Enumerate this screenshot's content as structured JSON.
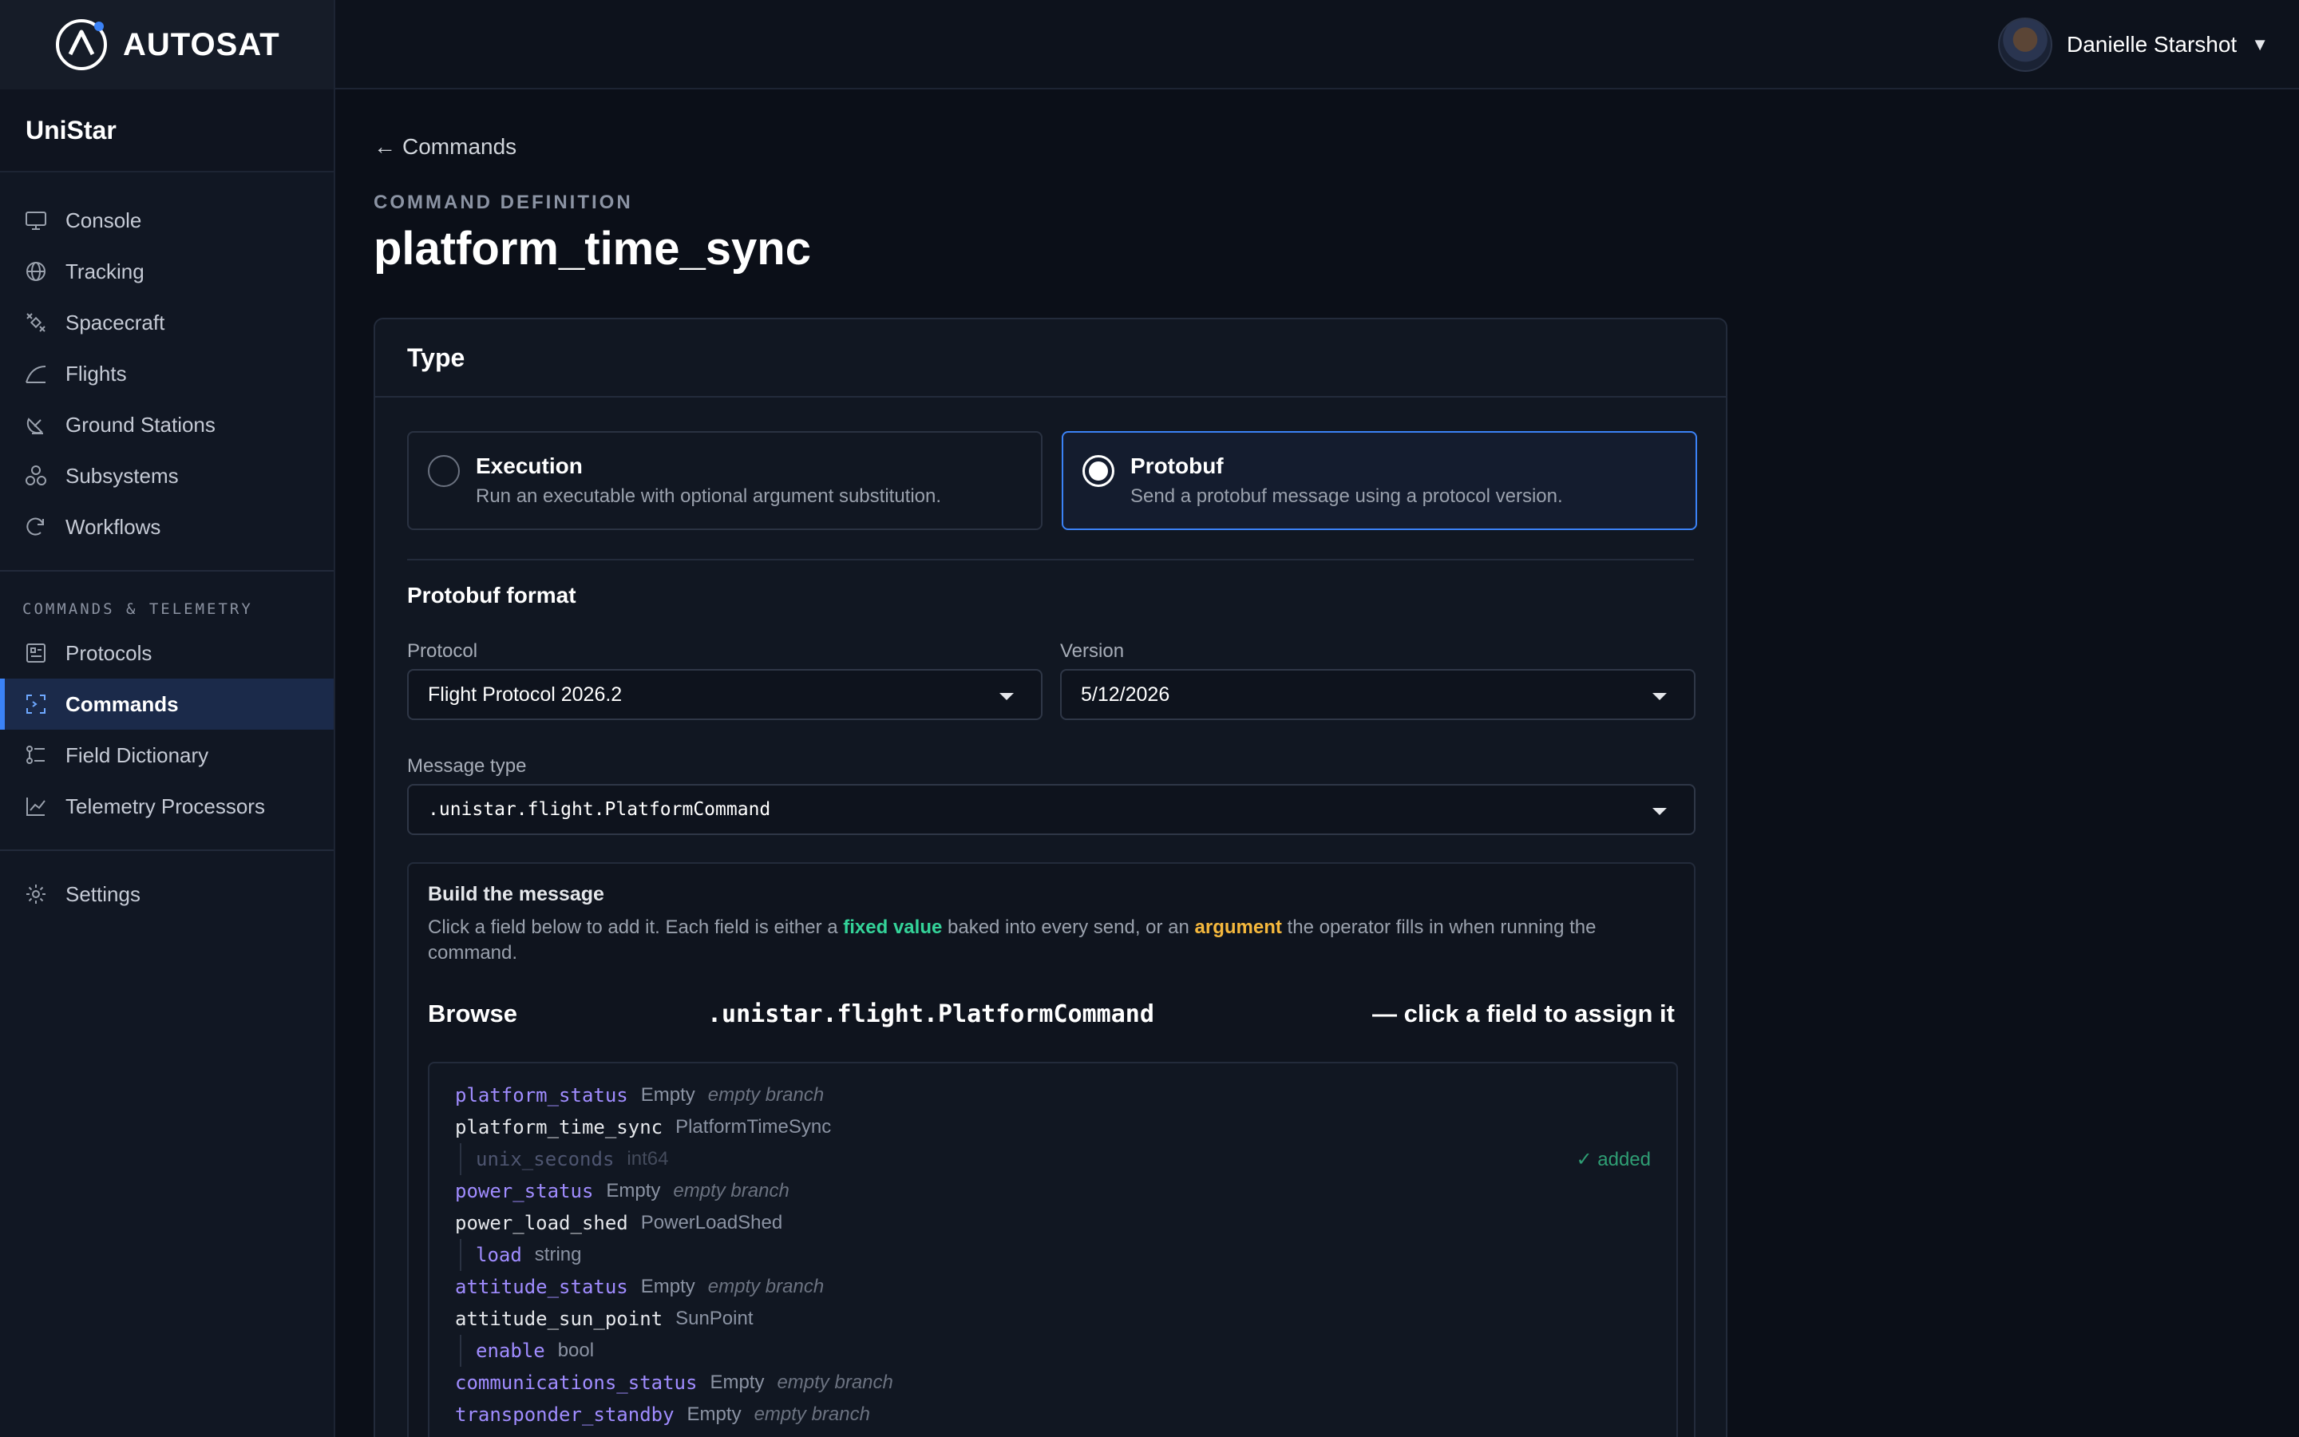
{
  "brand": {
    "name": "AUTOSAT",
    "org": "UniStar"
  },
  "user": {
    "name": "Danielle Starshot"
  },
  "sidebar": {
    "items": [
      {
        "label": "Console",
        "icon": "monitor-icon"
      },
      {
        "label": "Tracking",
        "icon": "globe-icon"
      },
      {
        "label": "Spacecraft",
        "icon": "satellite-icon"
      },
      {
        "label": "Flights",
        "icon": "trajectory-icon"
      },
      {
        "label": "Ground Stations",
        "icon": "antenna-icon"
      },
      {
        "label": "Subsystems",
        "icon": "subsystems-icon"
      },
      {
        "label": "Workflows",
        "icon": "workflow-icon"
      }
    ],
    "section_title": "COMMANDS & TELEMETRY",
    "section_items": [
      {
        "label": "Protocols",
        "icon": "protocol-icon"
      },
      {
        "label": "Commands",
        "icon": "command-icon",
        "active": true
      },
      {
        "label": "Field Dictionary",
        "icon": "dictionary-icon"
      },
      {
        "label": "Telemetry Processors",
        "icon": "chart-line-icon"
      }
    ],
    "settings": {
      "label": "Settings",
      "icon": "gear-icon"
    }
  },
  "page": {
    "back_label": "Commands",
    "eyebrow": "COMMAND DEFINITION",
    "title": "platform_time_sync"
  },
  "type_card": {
    "heading": "Type",
    "options": [
      {
        "title": "Execution",
        "desc": "Run an executable with optional argument substitution.",
        "selected": false
      },
      {
        "title": "Protobuf",
        "desc": "Send a protobuf message using a protocol version.",
        "selected": true
      }
    ]
  },
  "protobuf": {
    "heading": "Protobuf format",
    "protocol_label": "Protocol",
    "protocol_value": "Flight Protocol 2026.2",
    "version_label": "Version",
    "version_value": "5/12/2026",
    "message_type_label": "Message type",
    "message_type_value": ".unistar.flight.PlatformCommand"
  },
  "builder": {
    "title": "Build the message",
    "desc_1": "Click a field below to add it. Each field is either a ",
    "desc_fixed": "fixed value",
    "desc_2": " baked into every send, or an ",
    "desc_arg": "argument",
    "desc_3": " the operator fills in when running the command.",
    "browse_word": "Browse",
    "browse_type": ".unistar.flight.PlatformCommand",
    "browse_hint": "— click a field to assign it",
    "added_label": "✓ added"
  },
  "tree": [
    {
      "name": "platform_status",
      "type": "Empty",
      "note": "empty branch",
      "kind": "leaf",
      "child": false
    },
    {
      "name": "platform_time_sync",
      "type": "PlatformTimeSync",
      "note": "",
      "kind": "msg",
      "child": false
    },
    {
      "name": "unix_seconds",
      "type": "int64",
      "note": "",
      "kind": "dim",
      "child": true,
      "added": true
    },
    {
      "name": "power_status",
      "type": "Empty",
      "note": "empty branch",
      "kind": "leaf",
      "child": false
    },
    {
      "name": "power_load_shed",
      "type": "PowerLoadShed",
      "note": "",
      "kind": "msg",
      "child": false
    },
    {
      "name": "load",
      "type": "string",
      "note": "",
      "kind": "leaf",
      "child": true
    },
    {
      "name": "attitude_status",
      "type": "Empty",
      "note": "empty branch",
      "kind": "leaf",
      "child": false
    },
    {
      "name": "attitude_sun_point",
      "type": "SunPoint",
      "note": "",
      "kind": "msg",
      "child": false
    },
    {
      "name": "enable",
      "type": "bool",
      "note": "",
      "kind": "leaf",
      "child": true
    },
    {
      "name": "communications_status",
      "type": "Empty",
      "note": "empty branch",
      "kind": "leaf",
      "child": false
    },
    {
      "name": "transponder_standby",
      "type": "Empty",
      "note": "empty branch",
      "kind": "leaf",
      "child": false
    }
  ],
  "colors": {
    "accent": "#3b82f6",
    "fixed_value": "#34d399",
    "argument": "#f5b83d",
    "field_leaf": "#a08cff"
  }
}
